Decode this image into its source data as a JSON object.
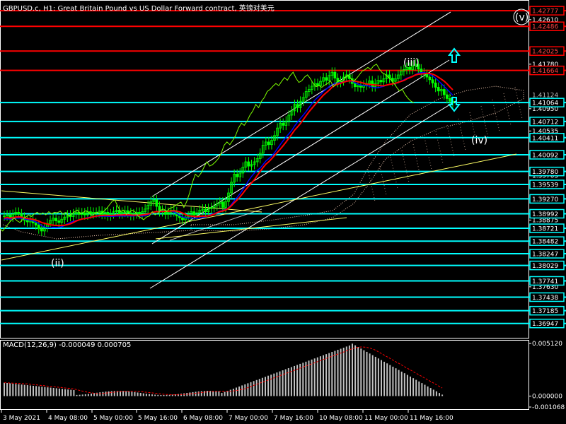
{
  "window": {
    "title": "GBPUSD.c, H1:  Great Britain Pound vs US Dollar Forward contract, 英镑对美元"
  },
  "colors": {
    "background": "#000000",
    "hline_red": "#ff0000",
    "hline_cyan": "#00ffff",
    "channel": "#ffffff",
    "trendline": "#ffff66",
    "cloud": "#f0c8b0",
    "ma_red": "#ff0000",
    "ma_blue": "#0000ff",
    "price_green": "#00ff00",
    "chikou": "#7cfc00",
    "macd_hist": "#c0c0c0",
    "macd_signal": "#ff0000",
    "arrow": "#00ffff"
  },
  "macd": {
    "label": "MACD(12,26,9) -0.000049 0.000705",
    "ticks": [
      "0.005120",
      "0.000000",
      "-0.001068"
    ]
  },
  "chart_data": {
    "type": "candlestick",
    "symbol": "GBPUSD.c",
    "timeframe": "H1",
    "ylim": [
      1.3668,
      1.4295
    ],
    "grid": false,
    "x_labels": [
      "3 May 2021",
      "4 May 08:00",
      "5 May 00:00",
      "5 May 16:00",
      "6 May 08:00",
      "7 May 00:00",
      "7 May 16:00",
      "10 May 08:00",
      "11 May 00:00",
      "11 May 16:00"
    ],
    "y_ticks_plain": [
      "1.42610",
      "1.41780",
      "1.40950",
      "1.40535",
      "1.39705",
      "1.38875",
      "1.37630"
    ],
    "hlines_red": [
      "1.42777",
      "1.42486",
      "1.42025",
      "1.41664"
    ],
    "hlines_cyan": [
      "1.41064",
      "1.40712",
      "1.40411",
      "1.40092",
      "1.39780",
      "1.39539",
      "1.39270",
      "1.38992",
      "1.38721",
      "1.38482",
      "1.38247",
      "1.38029",
      "1.37741",
      "1.37438",
      "1.37185",
      "1.36947"
    ],
    "price_tag_current": "1.41064",
    "price_tag_hidden": "1.41124",
    "wave_labels": [
      "(v)",
      "(iii)",
      "(iv)",
      "(ii)"
    ],
    "close_series": [
      1.3895,
      1.3897,
      1.3893,
      1.3898,
      1.3902,
      1.3899,
      1.3893,
      1.3887,
      1.3884,
      1.3889,
      1.3882,
      1.3878,
      1.3871,
      1.3867,
      1.3874,
      1.3881,
      1.3887,
      1.3891,
      1.3886,
      1.3883,
      1.3889,
      1.3893,
      1.3897,
      1.3894,
      1.3899,
      1.3902,
      1.3898,
      1.3901,
      1.3897,
      1.3903,
      1.3899,
      1.3902,
      1.3901,
      1.3904,
      1.3898,
      1.3902,
      1.3895,
      1.3899,
      1.3903,
      1.3906,
      1.3899,
      1.3902,
      1.3905,
      1.3901,
      1.3896,
      1.3899,
      1.3902,
      1.3898,
      1.3903,
      1.3908,
      1.3915,
      1.3922,
      1.3925,
      1.3913,
      1.3903,
      1.3906,
      1.3898,
      1.3902,
      1.3906,
      1.3903,
      1.3895,
      1.3892,
      1.3888,
      1.3893,
      1.3895,
      1.3903,
      1.3897,
      1.3901,
      1.3906,
      1.3908,
      1.3903,
      1.3909,
      1.3911,
      1.3914,
      1.3918,
      1.3921,
      1.3911,
      1.3922,
      1.3938,
      1.3958,
      1.3973,
      1.3968,
      1.3975,
      1.3986,
      1.3996,
      1.3988,
      1.3991,
      1.3996,
      1.4002,
      1.4012,
      1.4027,
      1.4033,
      1.4028,
      1.4036,
      1.4045,
      1.4059,
      1.4068,
      1.4064,
      1.4072,
      1.4083,
      1.4091,
      1.4103,
      1.4097,
      1.4109,
      1.4116,
      1.4127,
      1.4131,
      1.4137,
      1.4142,
      1.4138,
      1.4146,
      1.4153,
      1.4148,
      1.4157,
      1.4163,
      1.4152,
      1.4144,
      1.4147,
      1.4154,
      1.4158,
      1.4151,
      1.4142,
      1.4136,
      1.4138,
      1.4135,
      1.4139,
      1.4142,
      1.4147,
      1.4136,
      1.4142,
      1.4148,
      1.4145,
      1.4151,
      1.4158,
      1.4152,
      1.4146,
      1.4151,
      1.4158,
      1.4165,
      1.4168,
      1.4172,
      1.4168,
      1.4175,
      1.4178,
      1.4169,
      1.4162,
      1.4159,
      1.4154,
      1.4149,
      1.4143,
      1.4135,
      1.4128,
      1.4131,
      1.4121,
      1.4114,
      1.4109,
      1.4106
    ]
  }
}
